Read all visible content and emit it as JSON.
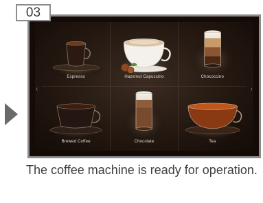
{
  "step_number": "03",
  "caption": "The coffee machine is ready for operation.",
  "screen": {
    "tiles": [
      {
        "label": "Espresso",
        "icon": "espresso-cup-icon"
      },
      {
        "label": "Hazelnut Capuccino",
        "icon": "cappuccino-cup-icon"
      },
      {
        "label": "Chococcino",
        "icon": "layered-glass-icon"
      },
      {
        "label": "Brewed Coffee",
        "icon": "coffee-cup-icon"
      },
      {
        "label": "Chocolate",
        "icon": "chocolate-glass-icon"
      },
      {
        "label": "Tea",
        "icon": "tea-cup-icon"
      }
    ],
    "left_arrow": "‹",
    "right_arrow": "›"
  },
  "colors": {
    "frame_border": "#8c8c8c",
    "screen_background": "#1c120c",
    "label_text": "#e8e0d6",
    "caption_text": "#3f3f3f"
  }
}
